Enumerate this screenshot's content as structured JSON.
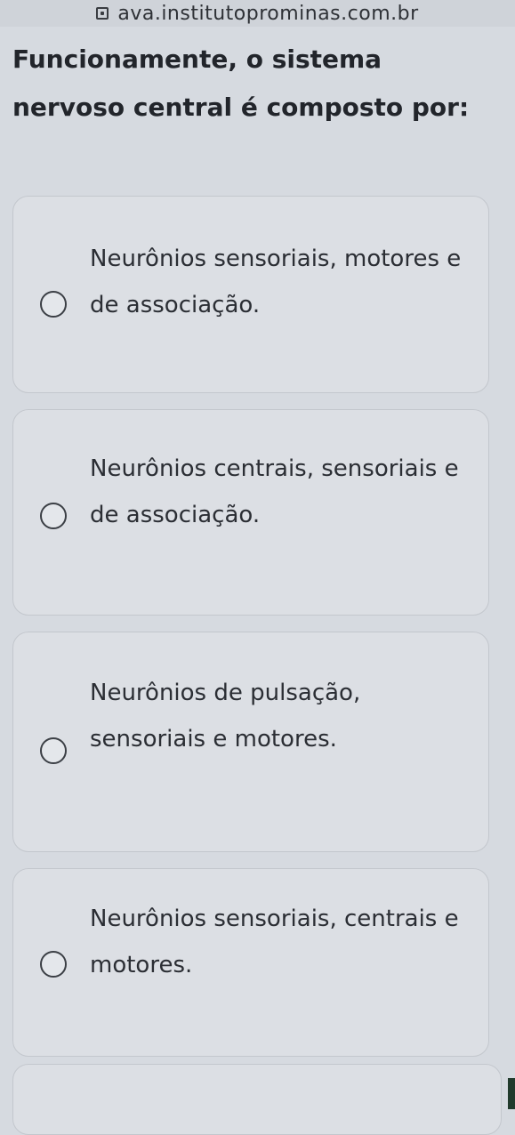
{
  "browser": {
    "url": "ava.institutoprominas.com.br"
  },
  "question": {
    "text": "Funcionamente, o sistema nervoso central é composto por:"
  },
  "options": [
    {
      "label": "Neurônios sensoriais, motores e de associação.",
      "selected": false
    },
    {
      "label": "Neurônios centrais, sensoriais e de associação.",
      "selected": false
    },
    {
      "label": "Neurônios de pulsação, sensoriais e motores.",
      "selected": false
    },
    {
      "label": "Neurônios sensoriais, centrais e motores.",
      "selected": false
    }
  ]
}
